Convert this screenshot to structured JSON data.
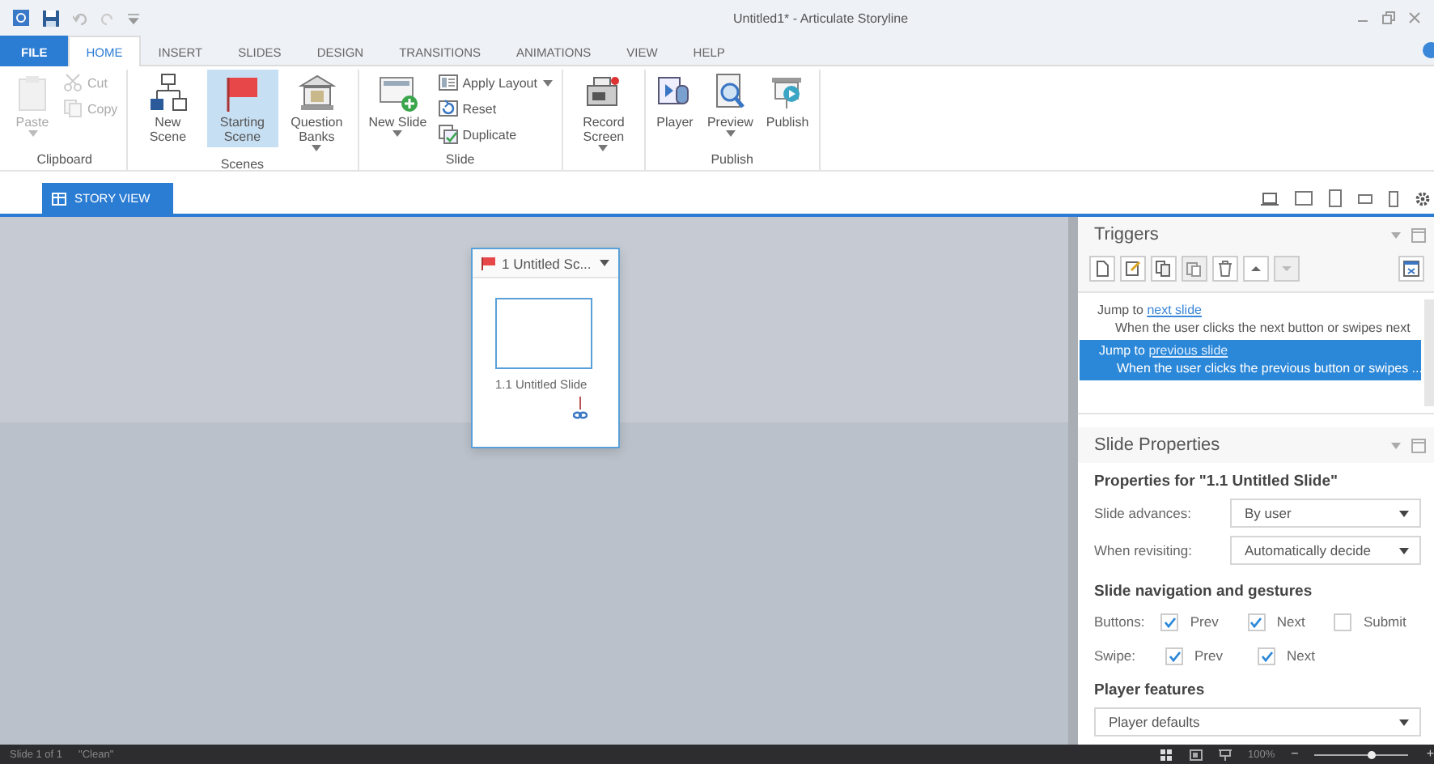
{
  "window": {
    "title": "Untitled1* - Articulate Storyline"
  },
  "ribbon_tabs": [
    {
      "label": "FILE",
      "kind": "file",
      "selected": false
    },
    {
      "label": "HOME",
      "kind": "tab",
      "selected": true
    },
    {
      "label": "INSERT",
      "kind": "tab",
      "selected": false
    },
    {
      "label": "SLIDES",
      "kind": "tab",
      "selected": false
    },
    {
      "label": "DESIGN",
      "kind": "tab",
      "selected": false
    },
    {
      "label": "TRANSITIONS",
      "kind": "tab",
      "selected": false
    },
    {
      "label": "ANIMATIONS",
      "kind": "tab",
      "selected": false
    },
    {
      "label": "VIEW",
      "kind": "tab",
      "selected": false
    },
    {
      "label": "HELP",
      "kind": "tab",
      "selected": false
    }
  ],
  "ribbon_groups": [
    {
      "label": "Clipboard",
      "buttons": [
        {
          "label": "Paste",
          "kind": "large",
          "dropdown": true,
          "disabled": true
        },
        {
          "label": "Cut",
          "kind": "small",
          "dropdown": false,
          "disabled": true
        },
        {
          "label": "Copy",
          "kind": "small",
          "dropdown": false,
          "disabled": true
        }
      ]
    },
    {
      "label": "Scenes",
      "buttons": [
        {
          "label": "New Scene",
          "kind": "large",
          "dropdown": false,
          "selected": false
        },
        {
          "label": "Starting Scene",
          "kind": "large",
          "dropdown": false,
          "selected": true
        },
        {
          "label": "Question Banks",
          "kind": "large",
          "dropdown": true,
          "selected": false
        }
      ]
    },
    {
      "label": "Slide",
      "buttons": [
        {
          "label": "New Slide",
          "kind": "large",
          "dropdown": true
        },
        {
          "label": "Apply Layout",
          "kind": "small",
          "dropdown": true
        },
        {
          "label": "Reset",
          "kind": "small",
          "dropdown": false
        },
        {
          "label": "Duplicate",
          "kind": "small",
          "dropdown": false
        }
      ]
    },
    {
      "buttons": [
        {
          "label": "Record Screen",
          "kind": "large",
          "dropdown": true
        }
      ]
    },
    {
      "label": "Publish",
      "buttons": [
        {
          "label": "Player",
          "kind": "large",
          "dropdown": false
        },
        {
          "label": "Preview",
          "kind": "large",
          "dropdown": true
        },
        {
          "label": "Publish",
          "kind": "large",
          "dropdown": false
        }
      ]
    }
  ],
  "view_tabs": [
    {
      "label": "STORY VIEW",
      "selected": true
    }
  ],
  "scene": {
    "title": "1 Untitled Sc...",
    "slides": [
      {
        "label": "1.1 Untitled Slide",
        "selected": true
      }
    ]
  },
  "triggers": {
    "title": "Triggers",
    "items": [
      {
        "action": "Jump to",
        "link": "next slide",
        "condition": "When the user clicks the next button or swipes next",
        "selected": false
      },
      {
        "action": "Jump to",
        "link": "previous slide",
        "condition": "When the user clicks the previous button or swipes ...",
        "selected": true
      }
    ]
  },
  "slide_properties": {
    "title": "Slide Properties",
    "heading": "Properties for \"1.1 Untitled Slide\"",
    "fields": [
      {
        "label": "Slide advances:",
        "value": "By user"
      },
      {
        "label": "When revisiting:",
        "value": "Automatically decide"
      }
    ],
    "navigation_heading": "Slide navigation and gestures",
    "navigation_rows": [
      {
        "label": "Buttons:",
        "options": [
          {
            "label": "Prev",
            "checked": true
          },
          {
            "label": "Next",
            "checked": true
          },
          {
            "label": "Submit",
            "checked": false
          }
        ]
      },
      {
        "label": "Swipe:",
        "options": [
          {
            "label": "Prev",
            "checked": true
          },
          {
            "label": "Next",
            "checked": true
          }
        ]
      }
    ],
    "player_heading": "Player features",
    "player_value": "Player defaults"
  },
  "status_bar": {
    "slide": "Slide 1 of 1",
    "theme": "\"Clean\"",
    "zoom": "100%",
    "zoom_out": "−",
    "zoom_in": "+",
    "zoom_level": {
      "level": 0.6
    }
  }
}
